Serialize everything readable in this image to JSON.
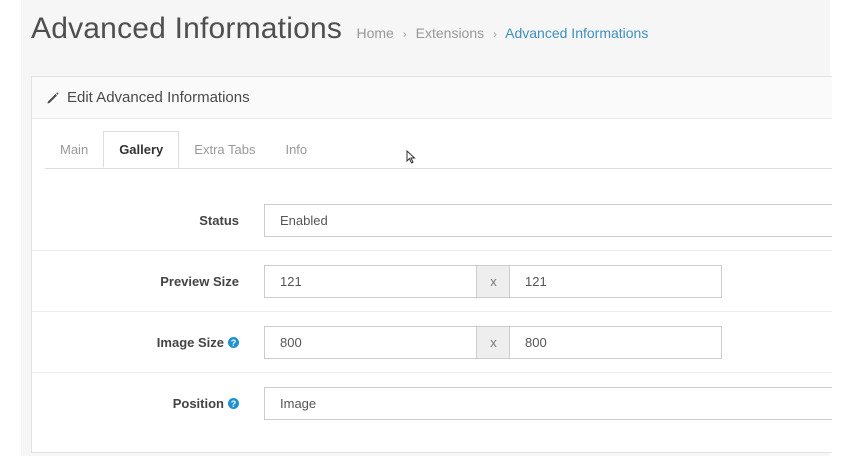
{
  "header": {
    "title": "Advanced Informations",
    "breadcrumb": [
      "Home",
      "Extensions",
      "Advanced Informations"
    ]
  },
  "panel": {
    "title": "Edit Advanced Informations",
    "icon": "pencil-icon"
  },
  "tabs": [
    {
      "label": "Main",
      "active": false
    },
    {
      "label": "Gallery",
      "active": true
    },
    {
      "label": "Extra Tabs",
      "active": false
    },
    {
      "label": "Info",
      "active": false
    }
  ],
  "form": {
    "status": {
      "label": "Status",
      "value": "Enabled"
    },
    "preview_size": {
      "label": "Preview Size",
      "width": "121",
      "separator": "x",
      "height": "121"
    },
    "image_size": {
      "label": "Image Size",
      "width": "800",
      "separator": "x",
      "height": "800",
      "help_icon": "question-icon"
    },
    "position": {
      "label": "Position",
      "value": "Image",
      "help_icon": "question-icon"
    }
  },
  "colors": {
    "accent": "#3e8fbf",
    "help": "#1e91cf"
  }
}
